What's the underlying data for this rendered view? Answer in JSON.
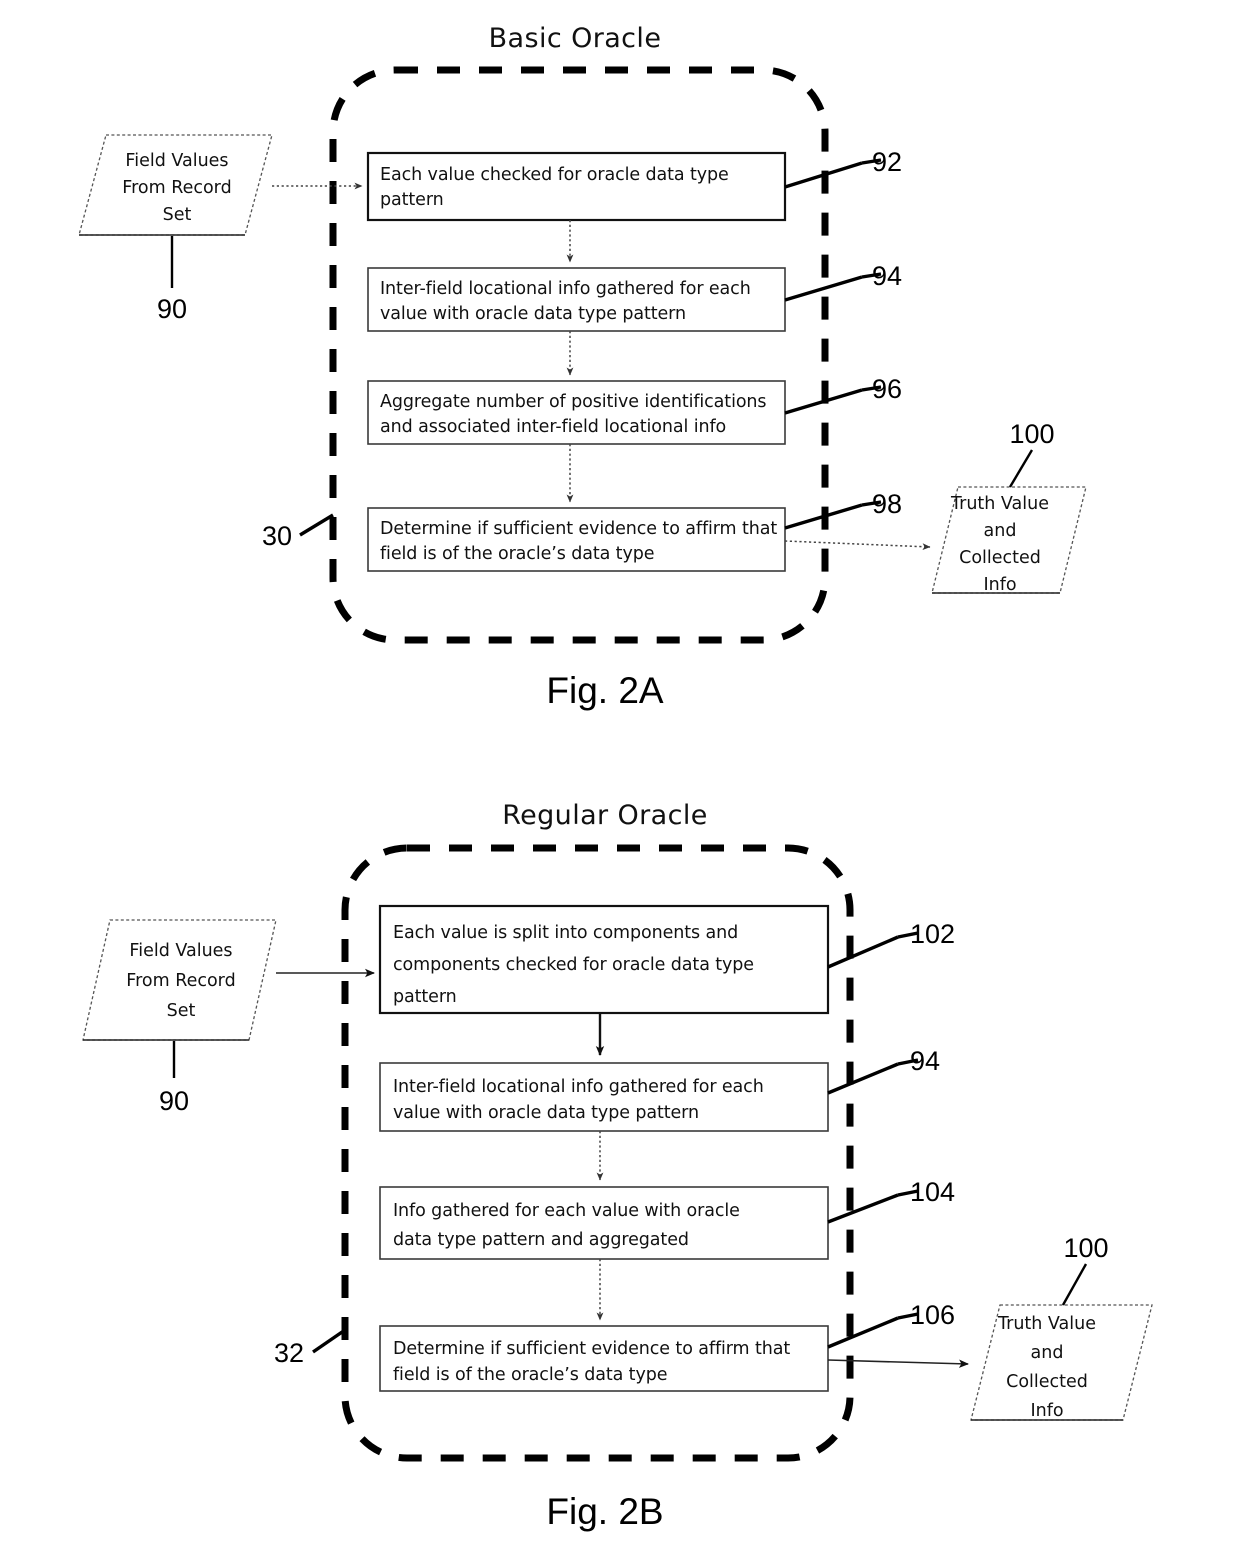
{
  "page": {
    "figures": [
      {
        "id": "fig-2a",
        "title": "Basic Oracle",
        "caption": "Fig. 2A",
        "container_ref": "30",
        "input": {
          "lines": [
            "Field Values",
            "From Record",
            "Set"
          ],
          "ref": "90"
        },
        "output": {
          "lines": [
            "Truth Value",
            "and",
            "Collected",
            "Info"
          ],
          "ref": "100"
        },
        "steps": [
          {
            "ref": "92",
            "lines": [
              "Each value checked for oracle data type",
              "pattern"
            ]
          },
          {
            "ref": "94",
            "lines": [
              "Inter-field locational info gathered for each",
              "value with oracle data type pattern"
            ]
          },
          {
            "ref": "96",
            "lines": [
              "Aggregate number of positive identifications",
              "and associated inter-field locational info"
            ]
          },
          {
            "ref": "98",
            "lines": [
              "Determine if sufficient evidence to affirm that",
              "field is of the oracle’s data type"
            ]
          }
        ]
      },
      {
        "id": "fig-2b",
        "title": "Regular Oracle",
        "caption": "Fig. 2B",
        "container_ref": "32",
        "input": {
          "lines": [
            "Field Values",
            "From Record",
            "Set"
          ],
          "ref": "90"
        },
        "output": {
          "lines": [
            "Truth Value",
            "and",
            "Collected",
            "Info"
          ],
          "ref": "100"
        },
        "steps": [
          {
            "ref": "102",
            "lines": [
              "Each value is split into components and",
              "components checked for oracle data type",
              "pattern"
            ]
          },
          {
            "ref": "94",
            "lines": [
              "Inter-field locational info gathered for each",
              "value with oracle data type pattern"
            ]
          },
          {
            "ref": "104",
            "lines": [
              "Info gathered for each value with oracle",
              "data type pattern and aggregated"
            ]
          },
          {
            "ref": "106",
            "lines": [
              "Determine if sufficient evidence to affirm that",
              "field is of the oracle’s data type"
            ]
          }
        ]
      }
    ]
  },
  "colors": {
    "ink": "#000000",
    "box_stroke": "#3a3a3a",
    "paper": "#ffffff"
  }
}
